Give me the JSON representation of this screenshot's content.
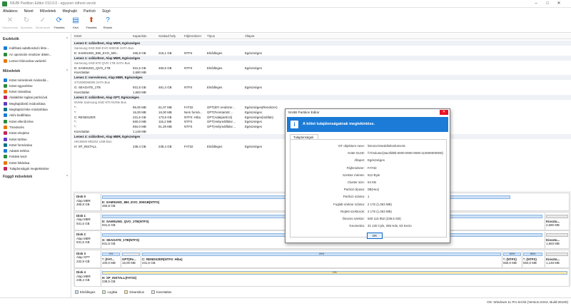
{
  "window": {
    "title": "NIUBI Partition Editor V10.0.0 - egyszeri otthoni verzió"
  },
  "menu": [
    "Általános",
    "Nézet",
    "Műveletek",
    "Meghajtó",
    "Partíció",
    "Súgó"
  ],
  "toolbar": [
    {
      "label": "Visszavonás",
      "icon": "undo-icon",
      "enabled": false,
      "glyph": "✕"
    },
    {
      "label": "Újraválás",
      "icon": "redo-icon",
      "enabled": false,
      "glyph": "↻"
    },
    {
      "label": "Alkalmazás",
      "icon": "apply-icon",
      "enabled": false,
      "glyph": "✓"
    },
    {
      "label": "Frissítés",
      "icon": "refresh-icon",
      "enabled": true,
      "glyph": "⟳"
    },
    {
      "label": "Kézi",
      "icon": "manual-icon",
      "enabled": true,
      "glyph": "▤"
    },
    {
      "label": "Frissítés",
      "icon": "update-icon",
      "enabled": true,
      "glyph": "⬆"
    },
    {
      "label": "Rólunk",
      "icon": "about-icon",
      "enabled": true,
      "glyph": "?"
    }
  ],
  "sidebar": {
    "section1": "Eszközök",
    "tools": [
      "Indítható adathordozó létre...",
      "Az operációs rendszer áttele...",
      "Lemez klónozása varázsló"
    ],
    "section2": "Műveletek",
    "ops": [
      "Kötet méretének módosítá...",
      "Kötet egyesítése",
      "Kötet másolása",
      "Átalakítás logikai partícióvá",
      "Meghajtóbetű módosítása",
      "Meghajtócímke módosítása",
      "Aktív beállítása",
      "Kötet ellenőrzése",
      "Töredezés",
      "Kötet elrejtése",
      "Kötet törlése",
      "Kötet formázása",
      "Adatok törlése",
      "Felületi teszt",
      "Kötet feltárása",
      "Tulajdonságok megtekintése"
    ],
    "section3": "Függő műveletek"
  },
  "grid": {
    "headers": [
      "Kötet",
      "Kapacitás",
      "Szabad hely",
      "Fájlrendszer",
      "Típus",
      "Állapot"
    ],
    "rows": [
      {
        "kind": "disk",
        "cells": [
          "Lemez 0: szilárdtest, Alap MBR, Egészséges",
          "",
          "",
          "",
          "",
          ""
        ]
      },
      {
        "kind": "sub",
        "cells": [
          "Samsung SSD 860 EVO 500GB SATA Bus",
          "",
          "",
          "",
          "",
          ""
        ]
      },
      {
        "kind": "vol",
        "cells": [
          "E: SAMSUNG_860_EVO_500...",
          "465,8 GB",
          "216,1 GB",
          "NTFS",
          "Elsődleges",
          "Egészséges"
        ]
      },
      {
        "kind": "disk",
        "cells": [
          "Lemez 1: szilárdtest, Alap MBR, Egészséges",
          "",
          "",
          "",
          "",
          ""
        ]
      },
      {
        "kind": "sub",
        "cells": [
          "Samsung SSD 870 QVO 1TB SATA Bus",
          "",
          "",
          "",
          "",
          ""
        ]
      },
      {
        "kind": "vol",
        "cells": [
          "D: SAMSUNG_QVO_1TB",
          "931,5 GB",
          "483,5 GB",
          "NTFS",
          "Elsődleges",
          "Egészséges"
        ]
      },
      {
        "kind": "vol",
        "cells": [
          "Kiosztatlan",
          "2,680 MB",
          "",
          "",
          "",
          ""
        ]
      },
      {
        "kind": "disk",
        "cells": [
          "Lemez 2: merevlemez, Alap MBR, Egészséges",
          "",
          "",
          "",
          "",
          ""
        ]
      },
      {
        "kind": "sub",
        "cells": [
          "ST1000DM005 SATA Bus",
          "",
          "",
          "",
          "",
          ""
        ]
      },
      {
        "kind": "vol",
        "cells": [
          "G: SEAGATE_1TB",
          "931,5 GB",
          "481,4 GB",
          "NTFS",
          "Elsődleges",
          "Egészséges"
        ]
      },
      {
        "kind": "vol",
        "cells": [
          "Kiosztatlan",
          "1,683 MB",
          "",
          "",
          "",
          ""
        ]
      },
      {
        "kind": "disk",
        "cells": [
          "Lemez 3: szilárdtest, Alap GPT, Egészséges",
          "",
          "",
          "",
          "",
          ""
        ]
      },
      {
        "kind": "sub",
        "cells": [
          "NVMe Samsung SSD 970 NVMe Bus",
          "",
          "",
          "",
          "",
          ""
        ]
      },
      {
        "kind": "vol",
        "cells": [
          "*:",
          "96,00 MB",
          "61,07 MB",
          "FAT32",
          "GPT(EFI rendszer...",
          "Egészséges(Rendszer)"
        ]
      },
      {
        "kind": "vol",
        "cells": [
          "*:",
          "16,00 MB",
          "16,00 MB",
          "Nem formá...",
          "GPT(Fenntartott ...",
          "Egészséges"
        ]
      },
      {
        "kind": "vol",
        "cells": [
          "C: RENDSZER",
          "231,5 GB",
          "173,8 GB",
          "NTFS: Hiba",
          "GPT(Adatpartíció)",
          "Egészséges(Indítás)"
        ]
      },
      {
        "kind": "vol",
        "cells": [
          "*:",
          "660,0 MB",
          "115,2 MB",
          "NTFS",
          "GPT(Helyreállítási ...",
          "Egészséges"
        ]
      },
      {
        "kind": "vol",
        "cells": [
          "*:",
          "594,0 MB",
          "91,29 MB",
          "NTFS",
          "GPT(Helyreállítási ...",
          "Egészséges"
        ]
      },
      {
        "kind": "vol",
        "cells": [
          "Kiosztatlan",
          "1,148 MB",
          "",
          "",
          "",
          ""
        ]
      },
      {
        "kind": "disk",
        "cells": [
          "Lemez 4: szilárdtest, Alap MBR, Egészséges",
          "",
          "",
          "",
          "",
          ""
        ]
      },
      {
        "kind": "sub",
        "cells": [
          "HIKSEMI MD202 USB Bus",
          "",
          "",
          "",
          "",
          ""
        ]
      },
      {
        "kind": "vol",
        "cells": [
          "H: XP_INSTALL",
          "238,4 GB",
          "238,4 GB",
          "FAT32",
          "Elsődleges",
          "Egészséges"
        ]
      }
    ]
  },
  "diskmap": [
    {
      "name": "Disk 0",
      "type": "Alap MBR",
      "size": "465,8 GB",
      "parts": [
        {
          "name": "E: SAMSUNG_860_EVO_500GB(NTFS)",
          "size": "465,8 GB",
          "pct": "",
          "w": 575,
          "color": "#cfe2f7"
        }
      ],
      "tail": {
        "name": "",
        "size": ""
      }
    },
    {
      "name": "Disk 1",
      "type": "Alap MBR",
      "size": "931,5 GB",
      "parts": [
        {
          "name": "D: SAMSUNG_QVO_1TB(NTFS)",
          "size": "931,5 GB",
          "pct": "",
          "w": 620,
          "color": "#cfe2f7"
        }
      ],
      "tail": {
        "name": "Kioszta...",
        "size": "2,680 MB"
      }
    },
    {
      "name": "Disk 2",
      "type": "Alap MBR",
      "size": "931,5 GB",
      "parts": [
        {
          "name": "G: SEAGATE_1TB(NTFS)",
          "size": "931,5 GB",
          "pct": "",
          "w": 620,
          "color": "#cfe2f7"
        }
      ],
      "tail": {
        "name": "Kioszta...",
        "size": "1,683 MB"
      }
    },
    {
      "name": "Disk 3",
      "type": "Alap GPT",
      "size": "232,9 GB",
      "parts": [
        {
          "name": "*: (FAT...",
          "size": "100,0 MB",
          "pct": "0%",
          "w": 28,
          "color": "#cfe2f7"
        },
        {
          "name": "GPT(Re...",
          "size": "16,00 MB",
          "pct": "",
          "w": 28,
          "color": "#e8e8e8"
        },
        {
          "name": "C: RENDSZER(NTFS: Hiba)",
          "size": "231,5 GB",
          "pct": "25%",
          "w": 506,
          "color": "#cfe2f7"
        },
        {
          "name": "*: (NTFS)",
          "size": "660,0 MB",
          "pct": "83%",
          "w": 28,
          "color": "#cfe2f7"
        },
        {
          "name": "*: (NTFS)",
          "size": "594,0 MB",
          "pct": "85%",
          "w": 30,
          "color": "#cfe2f7"
        }
      ],
      "tail": {
        "name": "Kioszta...",
        "size": "1,148 MB"
      }
    },
    {
      "name": "Disk 4",
      "type": "Alap MBR",
      "size": "238,4 GB",
      "parts": [
        {
          "name": "H: XP_INSTALL(FAT32)",
          "size": "238,5 GB",
          "pct": "0%",
          "w": 655,
          "color": "#fbe9a8"
        }
      ],
      "tail": {
        "name": "",
        "size": ""
      }
    }
  ],
  "legend": [
    {
      "label": "Elsődleges",
      "color": "#cfe2f7"
    },
    {
      "label": "Logikai",
      "color": "#d6eec8"
    },
    {
      "label": "Dinamikus",
      "color": "#fbe9a8"
    },
    {
      "label": "Kiosztatlan",
      "color": "#e8e8e8"
    }
  ],
  "status": "OS: Windows 11 Pro 64-bit (Version:24H2, Build:26100)",
  "dialog": {
    "title": "NIUBI Partition Editor",
    "close": "✕",
    "banner": "A kötet tulajdonságainak megtekintése.",
    "tab": "Tulajdonságok",
    "props": [
      {
        "k": "NT objektum neve:",
        "v": "\\Device\\HarddiskVolume15"
      },
      {
        "k": "Kötet GUID:",
        "v": "\\\\?\\Volume{3ac3fd9b-0000-0000-0000-110000000000}"
      },
      {
        "k": "Állapot:",
        "v": "Egészséges"
      },
      {
        "k": "Fájlrendszer:",
        "v": "FAT32"
      },
      {
        "k": "Szektor mérete:",
        "v": "512 Byte"
      },
      {
        "k": "Cluster size:",
        "v": "64 KB"
      },
      {
        "k": "Partíció típusa:",
        "v": "0B(Hex)"
      },
      {
        "k": "Partíció száma:",
        "v": "1"
      },
      {
        "k": "Foglalt szektor száma:",
        "v": "2 176 (1,063 MB)"
      },
      {
        "k": "Rejtett szektorok:",
        "v": "2 176 (1,063 MB)"
      },
      {
        "k": "Összes szektor:",
        "v": "500 115 952 (238,5 GB)"
      },
      {
        "k": "Geometria:",
        "v": "31 130 Cyls, 255 Hds, 63 Secto"
      }
    ],
    "ok": "OK"
  }
}
